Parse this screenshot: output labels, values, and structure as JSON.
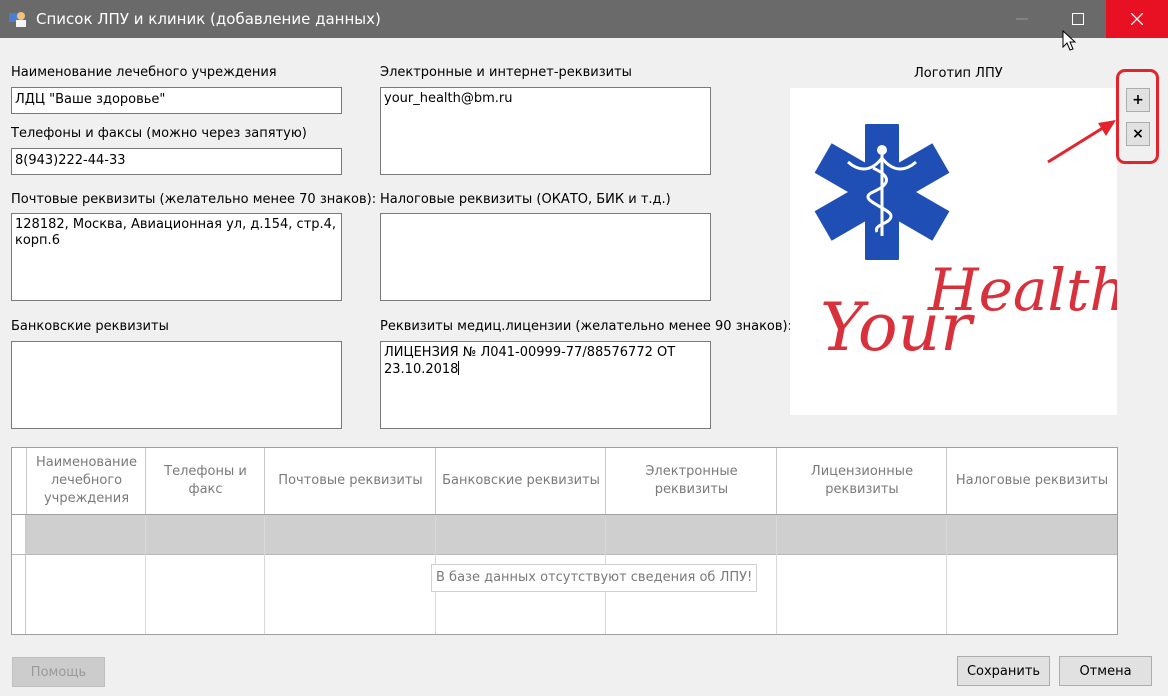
{
  "window": {
    "title": "Список ЛПУ и клиник (добавление данных)"
  },
  "form": {
    "name_label": "Наименование лечебного учреждения",
    "name_value": "ЛДЦ \"Ваше здоровье\"",
    "phones_label": "Телефоны и факсы (можно через запятую)",
    "phones_value": "8(943)222-44-33",
    "postal_label": "Почтовые реквизиты (желательно менее 70 знаков):",
    "postal_value": "128182, Москва, Авиационная ул, д.154, стр.4, корп.6",
    "bank_label": "Банковские реквизиты",
    "bank_value": "",
    "electronic_label": "Электронные и интернет-реквизиты",
    "electronic_value": "your_health@bm.ru",
    "tax_label": "Налоговые реквизиты (ОКАТО, БИК и т.д.)",
    "tax_value": "",
    "license_label": "Реквизиты медиц.лицензии (желательно менее 90 знаков):",
    "license_value": "ЛИЦЕНЗИЯ № Л041-00999-77/88576772 ОТ 23.10.2018"
  },
  "logo": {
    "label": "Логотип ЛПУ",
    "add_button": "+",
    "remove_button": "×",
    "text_health": "Health",
    "text_your": "Your",
    "star_color": "#1f4fb4",
    "text_color": "#d8313c"
  },
  "grid": {
    "columns": [
      "Наименование лечебного учреждения",
      "Телефоны и факс",
      "Почтовые реквизиты",
      "Банковские реквизиты",
      "Электронные реквизиты",
      "Лицензионные реквизиты",
      "Налоговые реквизиты"
    ],
    "empty_message": "В базе данных отсутствуют сведения об ЛПУ!"
  },
  "buttons": {
    "help": "Помощь",
    "save": "Сохранить",
    "cancel": "Отмена"
  },
  "colors": {
    "titlebar": "#6a6a6a",
    "close_hover": "#e81123",
    "annotation": "#e3242b"
  }
}
